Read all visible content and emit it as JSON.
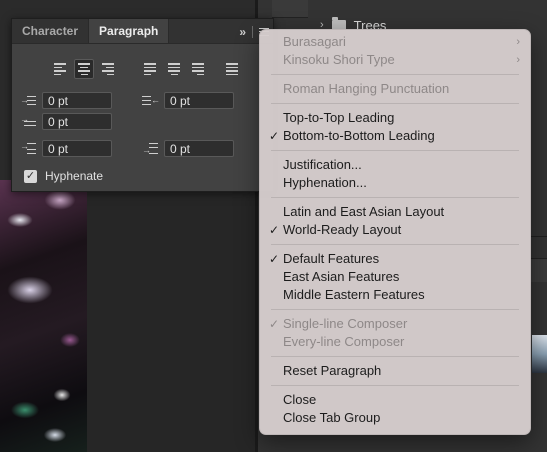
{
  "paragraph_panel": {
    "tabs": [
      {
        "label": "Character",
        "active": false
      },
      {
        "label": "Paragraph",
        "active": true
      }
    ],
    "collapse_label": "»",
    "alignment_buttons": [
      "align-left",
      "align-center",
      "align-right",
      "justify-last-left",
      "justify-last-center",
      "justify-last-right",
      "justify-all"
    ],
    "selected_alignment": "align-center",
    "fields": {
      "left_indent": "0 pt",
      "right_indent": "0 pt",
      "first_line_indent": "0 pt",
      "space_before": "0 pt",
      "space_after": "0 pt"
    },
    "hyphenate": {
      "label": "Hyphenate",
      "checked": true
    }
  },
  "layers_panel": {
    "group_name": "Trees"
  },
  "context_menu": {
    "sections": [
      [
        {
          "label": "Burasagari",
          "disabled": true,
          "submenu": true
        },
        {
          "label": "Kinsoku Shori Type",
          "disabled": true,
          "submenu": true
        }
      ],
      [
        {
          "label": "Roman Hanging Punctuation",
          "disabled": true
        }
      ],
      [
        {
          "label": "Top-to-Top Leading",
          "disabled": false
        },
        {
          "label": "Bottom-to-Bottom Leading",
          "disabled": false,
          "checked": true
        }
      ],
      [
        {
          "label": "Justification...",
          "disabled": false
        },
        {
          "label": "Hyphenation...",
          "disabled": false
        }
      ],
      [
        {
          "label": "Latin and East Asian Layout",
          "disabled": false
        },
        {
          "label": "World-Ready Layout",
          "disabled": false,
          "checked": true
        }
      ],
      [
        {
          "label": "Default Features",
          "disabled": false,
          "checked": true
        },
        {
          "label": "East Asian Features",
          "disabled": false
        },
        {
          "label": "Middle Eastern Features",
          "disabled": false
        }
      ],
      [
        {
          "label": "Single-line Composer",
          "disabled": true,
          "checked": true
        },
        {
          "label": "Every-line Composer",
          "disabled": true
        }
      ],
      [
        {
          "label": "Reset Paragraph",
          "disabled": false
        }
      ],
      [
        {
          "label": "Close",
          "disabled": false
        },
        {
          "label": "Close Tab Group",
          "disabled": false
        }
      ]
    ],
    "check_glyph": "✓",
    "submenu_glyph": "›"
  },
  "colors": {
    "panel_bg": "#424242",
    "menu_bg": "#d6cece",
    "menu_disabled_text": "#8e8888"
  }
}
